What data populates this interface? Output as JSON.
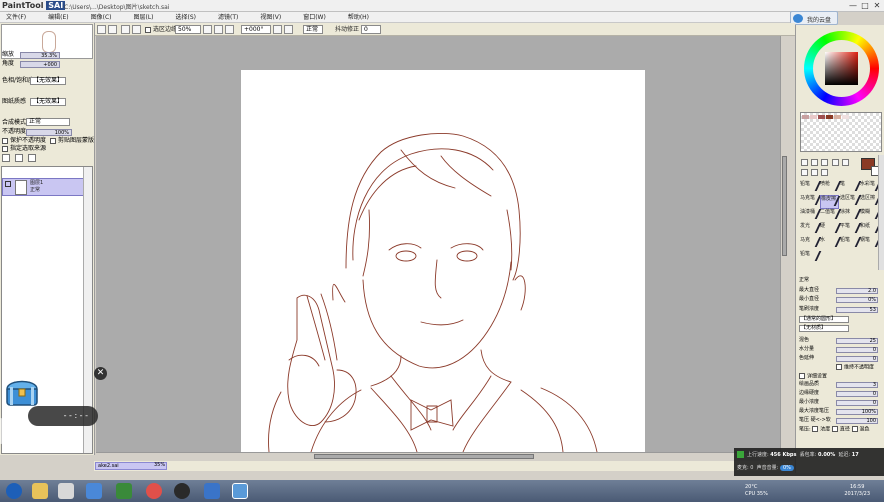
{
  "window": {
    "logo_prefix": "PaintTool",
    "logo_sai": "SAI",
    "title_path": "C:\\Users\\...\\Desktop\\图片\\sketch.sai",
    "cloud_button": "我的云盘",
    "controls": [
      "—",
      "□",
      "✕"
    ]
  },
  "menu": [
    "文件(F)",
    "编辑(E)",
    "图像(C)",
    "图层(L)",
    "选择(S)",
    "滤镜(T)",
    "视图(V)",
    "窗口(W)",
    "帮助(H)"
  ],
  "toolbar": {
    "select_label": "选区边缘",
    "zoom": "50%",
    "rotation": "+000°",
    "blend": "正常",
    "stabilizer_label": "抖动修正",
    "stabilizer": "0"
  },
  "left_panel": {
    "zoom_label": "缩放",
    "zoom_value": "35.3%",
    "angle_label": "角度",
    "angle_value": "+000",
    "filter1_label": "色相/饱和度",
    "filter1_value": "【无效果】",
    "filter2_label": "图纸质感",
    "filter2_value": "【无效果】",
    "blend_label": "合成模式",
    "blend_value": "正常",
    "opacity_label": "不透明度",
    "opacity_value": "100%",
    "check1": "保护不透明度",
    "check2": "剪贴图层蒙版",
    "check3": "指定选取来源",
    "layer_name": "图层1",
    "layer_mode": "正常"
  },
  "status": {
    "file": "ake2.sai",
    "zoom": "35%"
  },
  "right_panel": {
    "brushes": [
      "铅笔",
      "喷枪",
      "笔",
      "水彩笔",
      "马克笔",
      "橡皮擦",
      "选区笔",
      "选区擦",
      "油漆桶",
      "二值笔",
      "涂抹",
      "模糊",
      "发光",
      "硬",
      "平笔",
      "和纸",
      "马克",
      "水",
      "铅笔",
      "钢笔"
    ],
    "selected_brush": 5,
    "extra_brush": "铅笔",
    "shape_label": "正常",
    "max_size_label": "最大直径",
    "max_size_value": "2.0",
    "min_size_label": "最小直径",
    "min_size_value": "0%",
    "density_label": "笔刷浓度",
    "density_value": "53",
    "texture_label": "【通常的圆形】",
    "texture2_label": "【无材质】",
    "mix_label": "混色",
    "mix_value": "25",
    "water_label": "水分量",
    "water_value": "0",
    "keep_label": "色延伸",
    "keep_value": "0",
    "keep_opacity": "维持不透明度",
    "detail_label": "详细设置",
    "quality_label": "绘画品质",
    "quality_value": "3",
    "hard_label": "边缘硬度",
    "hard_value": "0",
    "min_density_label": "最小浓度",
    "min_density_value": "0",
    "max_pressure_label": "最大浓度笔压",
    "max_pressure_value": "100%",
    "pressure_label": "笔压 硬<->软",
    "pressure_value": "100",
    "pressure_check": "笔压:",
    "pressure_opts": [
      "浓度",
      "直径",
      "混色"
    ]
  },
  "net": {
    "upload_label": "上行速度:",
    "upload": "456 Kbps",
    "loss_label": "丢包率:",
    "loss": "0.00%",
    "delay_label": "延迟:",
    "delay": "17",
    "mic_label": "麦克:",
    "mic": "0",
    "pill": "0%",
    "cpu_label": "声音音量:"
  },
  "tray": {
    "weather": "20°C",
    "weather2": "CPU 35%",
    "time": "16:59",
    "date": "2017/3/23"
  },
  "widget": {
    "timer": "- - : - -",
    "close": "✕"
  },
  "colors": {
    "accent_selection": "#c9c6f2",
    "sketch_line": "#8b3a2a",
    "main_color": "#8a3a25"
  }
}
